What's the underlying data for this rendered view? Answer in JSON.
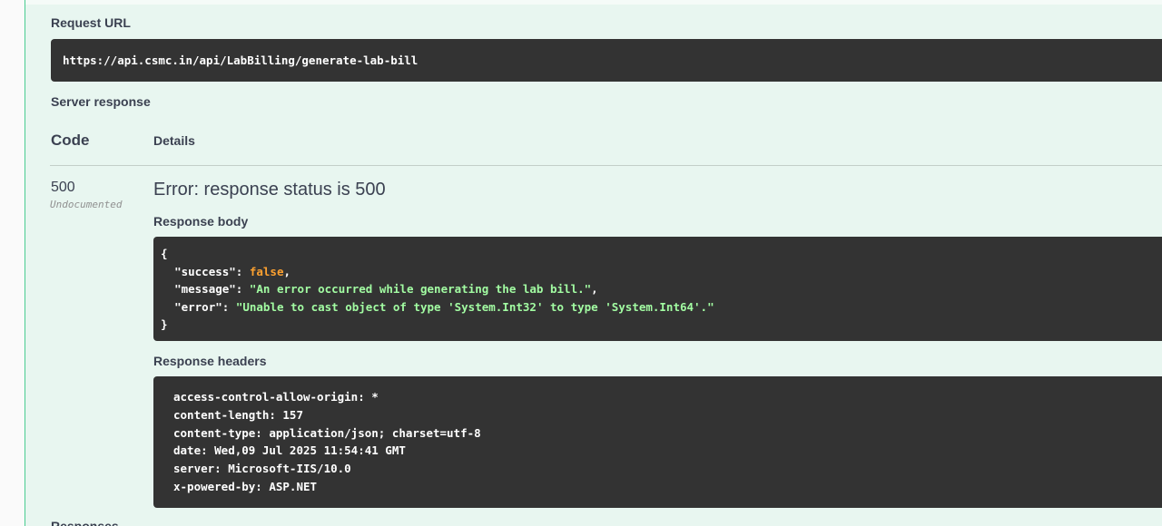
{
  "request_url": {
    "label": "Request URL",
    "value": "https://api.csmc.in/api/LabBilling/generate-lab-bill"
  },
  "server_response": {
    "label": "Server response",
    "columns": {
      "code": "Code",
      "details": "Details"
    },
    "row": {
      "code": "500",
      "code_note": "Undocumented",
      "error": "Error: response status is 500",
      "body_label": "Response body",
      "body": {
        "open": "{",
        "close": "}",
        "lines": [
          {
            "key": "\"success\"",
            "sep": ": ",
            "value": "false",
            "type": "bool",
            "trail": ","
          },
          {
            "key": "\"message\"",
            "sep": ": ",
            "value": "\"An error occurred while generating the lab bill.\"",
            "type": "str",
            "trail": ","
          },
          {
            "key": "\"error\"",
            "sep": ": ",
            "value": "\"Unable to cast object of type 'System.Int32' to type 'System.Int64'.\"",
            "type": "str",
            "trail": ""
          }
        ]
      },
      "headers_label": "Response headers",
      "headers": [
        "access-control-allow-origin: *",
        "content-length: 157",
        "content-type: application/json; charset=utf-8",
        "date: Wed,09 Jul 2025 11:54:41 GMT",
        "server: Microsoft-IIS/10.0",
        "x-powered-by: ASP.NET"
      ]
    }
  },
  "next_section_label": "Responses",
  "colors": {
    "panel_bg": "#e8f6f0",
    "accent_green": "#49cc90",
    "code_bg": "#333333",
    "json_string": "#a2fca2",
    "json_bool": "#fca130"
  }
}
